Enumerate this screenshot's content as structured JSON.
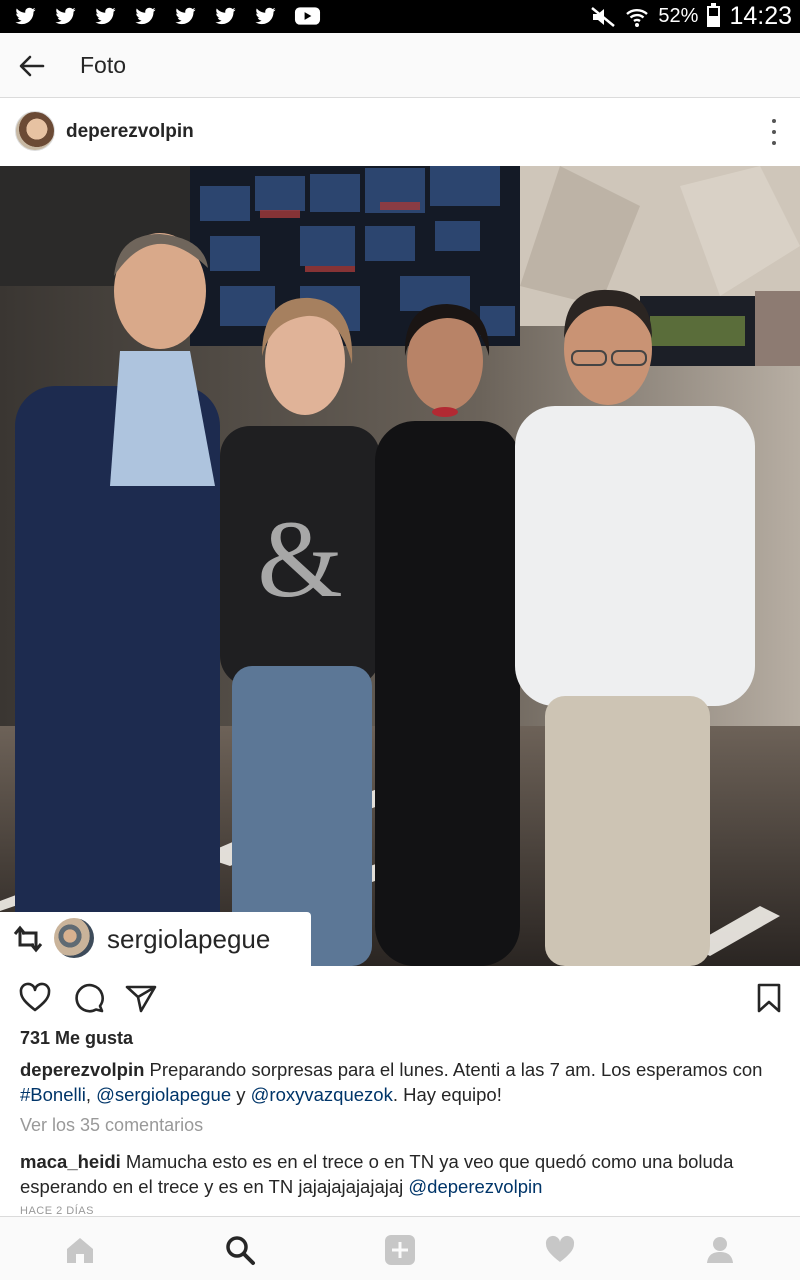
{
  "status_bar": {
    "notification_icons": [
      "twitter-icon",
      "twitter-icon",
      "twitter-icon",
      "twitter-icon",
      "twitter-icon",
      "twitter-icon",
      "twitter-icon",
      "youtube-icon"
    ],
    "battery_percent": "52%",
    "battery_level": 0.52,
    "time": "14:23"
  },
  "header": {
    "title": "Foto"
  },
  "post": {
    "username": "deperezvolpin",
    "repost": {
      "username": "sergiolapegue"
    },
    "likes": "731 Me gusta",
    "caption": {
      "username": "deperezvolpin",
      "text_1": "Preparando sorpresas para el lunes. Atenti a las 7 am. Los esperamos con ",
      "tag_1": "#Bonelli",
      "sep_1": ", ",
      "mention_1": "@sergiolapegue",
      "sep_2": " y ",
      "mention_2": "@roxyvazquezok",
      "text_2": ". Hay equipo!"
    },
    "view_comments": "Ver los 35 comentarios",
    "comment": {
      "username": "maca_heidi",
      "text": "Mamucha esto es en el trece o en TN ya veo que quedó como una boluda esperando en el trece y es en TN jajajajajajajaj ",
      "mention": "@deperezvolpin"
    },
    "time_ago": "HACE 2 DÍAS"
  },
  "colors": {
    "link": "#003569",
    "text": "#262626",
    "muted": "#999999",
    "nav_inactive": "#c7c7c7"
  }
}
